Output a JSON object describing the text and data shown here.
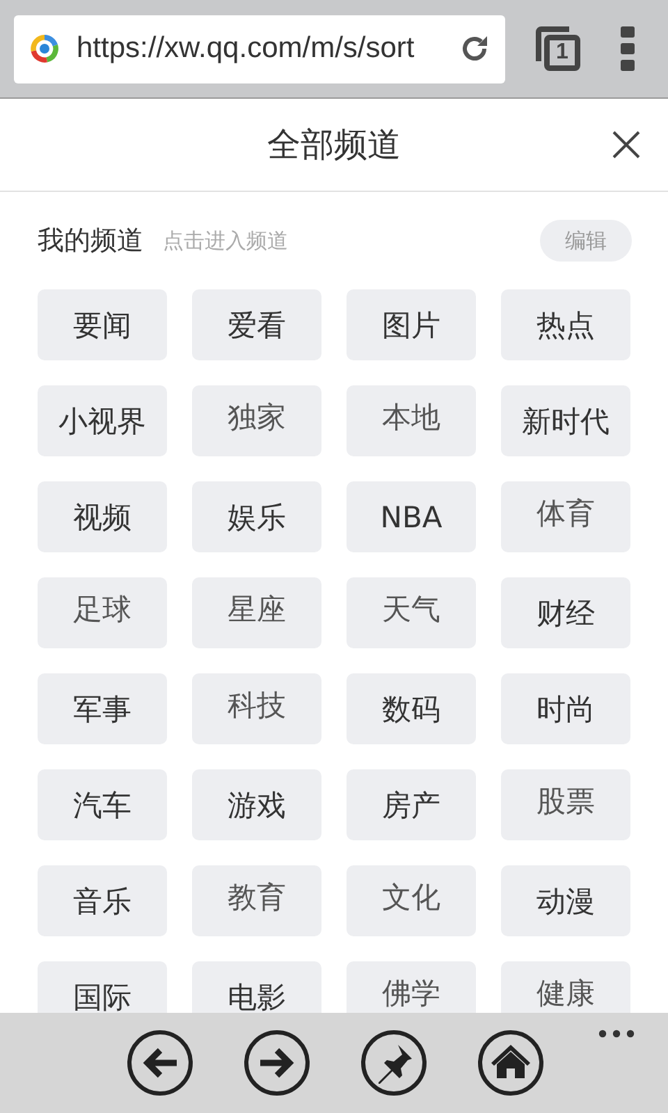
{
  "browser": {
    "url": "https://xw.qq.com/m/s/sort",
    "tab_count": "1"
  },
  "header": {
    "title": "全部频道"
  },
  "section": {
    "title": "我的频道",
    "hint": "点击进入频道",
    "edit_label": "编辑"
  },
  "channels": [
    {
      "label": "要闻",
      "kind": "plain"
    },
    {
      "label": "爱看",
      "kind": "plain"
    },
    {
      "label": "图片",
      "kind": "plain"
    },
    {
      "label": "热点",
      "kind": "plain"
    },
    {
      "label": "小视界",
      "kind": "plain"
    },
    {
      "label": "独家",
      "kind": "raised"
    },
    {
      "label": "本地",
      "kind": "raised"
    },
    {
      "label": "新时代",
      "kind": "plain"
    },
    {
      "label": "视频",
      "kind": "plain"
    },
    {
      "label": "娱乐",
      "kind": "plain"
    },
    {
      "label": "NBA",
      "kind": "plain"
    },
    {
      "label": "体育",
      "kind": "raised"
    },
    {
      "label": "足球",
      "kind": "raised"
    },
    {
      "label": "星座",
      "kind": "raised"
    },
    {
      "label": "天气",
      "kind": "raised"
    },
    {
      "label": "财经",
      "kind": "plain"
    },
    {
      "label": "军事",
      "kind": "plain"
    },
    {
      "label": "科技",
      "kind": "raised"
    },
    {
      "label": "数码",
      "kind": "plain"
    },
    {
      "label": "时尚",
      "kind": "plain"
    },
    {
      "label": "汽车",
      "kind": "plain"
    },
    {
      "label": "游戏",
      "kind": "plain"
    },
    {
      "label": "房产",
      "kind": "plain"
    },
    {
      "label": "股票",
      "kind": "raised"
    },
    {
      "label": "音乐",
      "kind": "plain"
    },
    {
      "label": "教育",
      "kind": "raised"
    },
    {
      "label": "文化",
      "kind": "raised"
    },
    {
      "label": "动漫",
      "kind": "plain"
    },
    {
      "label": "国际",
      "kind": "plain"
    },
    {
      "label": "电影",
      "kind": "plain"
    },
    {
      "label": "佛学",
      "kind": "raised"
    },
    {
      "label": "健康",
      "kind": "raised"
    }
  ]
}
